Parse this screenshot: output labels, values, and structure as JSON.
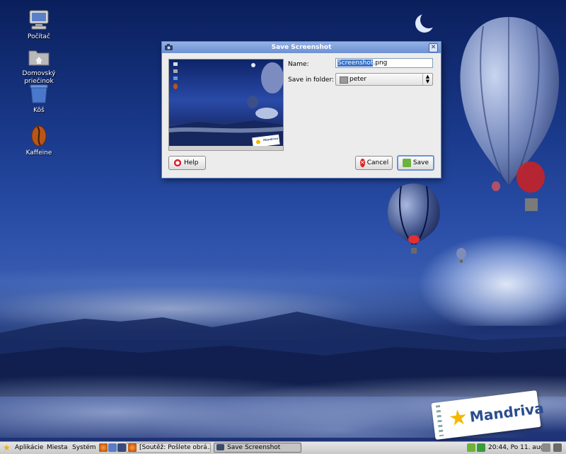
{
  "desktop": {
    "icons": [
      {
        "label": "Počítač"
      },
      {
        "label": "Domovský priečinok"
      },
      {
        "label": "Kôš"
      },
      {
        "label": "Kaffeine"
      }
    ],
    "wallpaper_brand": "Mandriva"
  },
  "dialog": {
    "title": "Save Screenshot",
    "name_label": "Name:",
    "name_value_selected": "Screenshot",
    "name_value_rest": ".png",
    "folder_label": "Save in folder:",
    "folder_value": "peter",
    "help_button": "Help",
    "cancel_button": "Cancel",
    "save_button": "Save",
    "preview_brand": "Mandriva"
  },
  "taskbar": {
    "menu_apps": "Aplikácie",
    "menu_places": "Miesta",
    "menu_system": "Systém",
    "tasks": [
      {
        "label": "[Soutěž: Pošlete obrá..."
      },
      {
        "label": "Save Screenshot"
      }
    ],
    "clock": "20:44, Po 11. aug"
  },
  "colors": {
    "titlebar": "#7c9ddb",
    "selection": "#3a72c8",
    "desktop_top": "#0a1f5c",
    "brand_star": "#f5b800"
  }
}
